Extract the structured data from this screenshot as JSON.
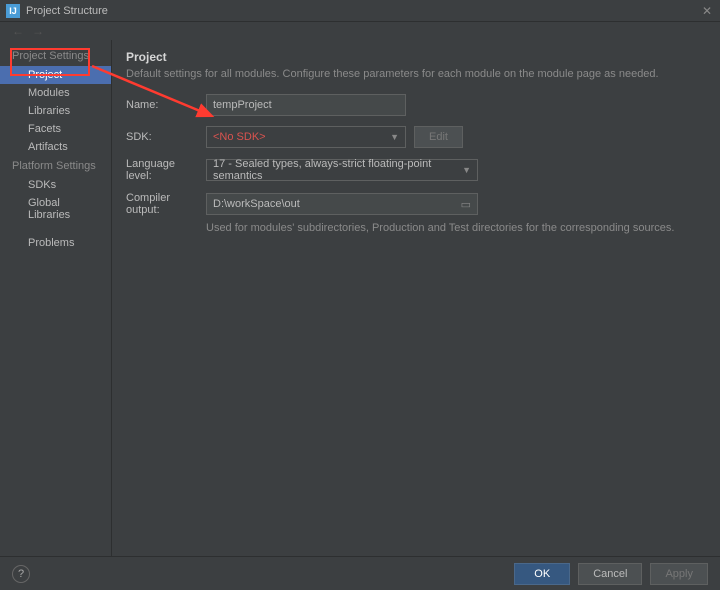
{
  "window": {
    "title": "Project Structure"
  },
  "sidebar": {
    "section1": "Project Settings",
    "items1": [
      {
        "label": "Project"
      },
      {
        "label": "Modules"
      },
      {
        "label": "Libraries"
      },
      {
        "label": "Facets"
      },
      {
        "label": "Artifacts"
      }
    ],
    "section2": "Platform Settings",
    "items2": [
      {
        "label": "SDKs"
      },
      {
        "label": "Global Libraries"
      }
    ],
    "section3_item": "Problems"
  },
  "main": {
    "heading": "Project",
    "subtitle": "Default settings for all modules. Configure these parameters for each module on the module page as needed.",
    "fields": {
      "name_label": "Name:",
      "name_value": "tempProject",
      "sdk_label": "SDK:",
      "sdk_value": "<No SDK>",
      "edit_btn": "Edit",
      "lang_label": "Language level:",
      "lang_value": "17 - Sealed types, always-strict floating-point semantics",
      "out_label": "Compiler output:",
      "out_value": "D:\\workSpace\\out",
      "out_hint": "Used for modules' subdirectories, Production and Test directories for the corresponding sources."
    }
  },
  "footer": {
    "ok": "OK",
    "cancel": "Cancel",
    "apply": "Apply"
  }
}
